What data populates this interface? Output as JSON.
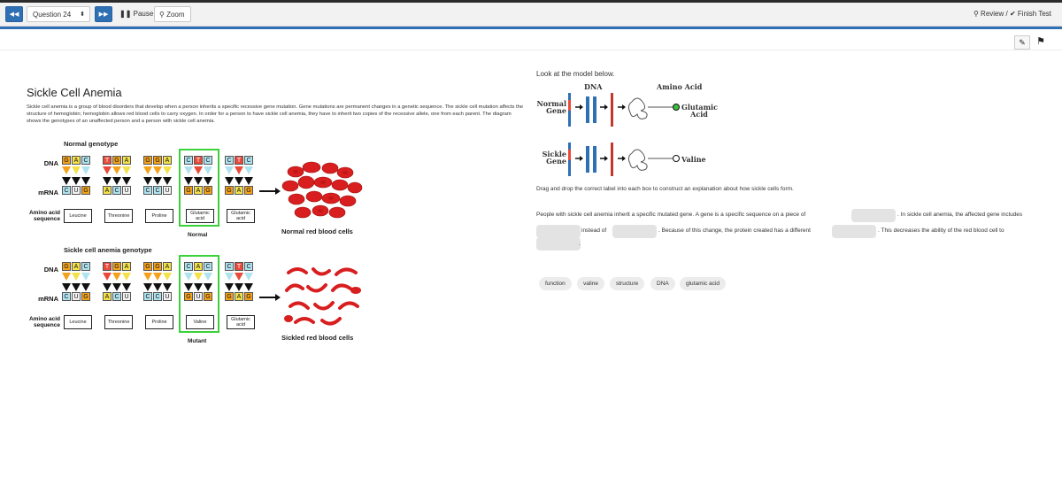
{
  "toolbar": {
    "prev_icon": "rewind-icon",
    "question_select": "Question 24",
    "next_icon": "fast-forward-icon",
    "pause_label": "Pause",
    "zoom_label": "Zoom",
    "review_label": "Review /",
    "finish_label": "Finish Test"
  },
  "icons": {
    "note": "note-edit-icon",
    "flag": "flag-icon"
  },
  "passage": {
    "title": "Sickle Cell Anemia",
    "intro": "Sickle cell anemia is a group of blood disorders that develop when a person inherits a specific recessive gene mutation. Gene mutations are permanent changes in a genetic sequence. The sickle cell mutation affects the structure of hemoglobin; hemoglobin allows red blood cells to carry oxygen. In order for a person to have sickle cell anemia, they have to inherit two copies of the recessive allele, one from each parent. The diagram shows the genotypes of an unaffected person and a person with sickle cell anemia.",
    "diagram": {
      "normal": {
        "heading": "Normal genotype",
        "dna_label": "DNA",
        "mrna_label": "mRNA",
        "aa_label": "Amino acid sequence",
        "dna": [
          "GAC",
          "TGA",
          "GGA",
          "CTC",
          "CTC"
        ],
        "mrna": [
          "CUG",
          "ACU",
          "CCU",
          "GAG",
          "GAG"
        ],
        "amino_acids": [
          "Leucine",
          "Threonine",
          "Proline",
          "Glutamic acid",
          "Glutamic acid"
        ],
        "highlight_caption": "Normal",
        "cells_caption": "Normal red blood cells"
      },
      "sickle": {
        "heading": "Sickle cell anemia genotype",
        "dna_label": "DNA",
        "mrna_label": "mRNA",
        "aa_label": "Amino acid sequence",
        "dna": [
          "GAC",
          "TGA",
          "GGA",
          "CAC",
          "CTC"
        ],
        "mrna": [
          "CUG",
          "ACU",
          "CCU",
          "GUG",
          "GAG"
        ],
        "amino_acids": [
          "Leucine",
          "Threonine",
          "Proline",
          "Valine",
          "Glutamic acid"
        ],
        "highlight_caption": "Mutant",
        "cells_caption": "Sickled red blood cells"
      }
    }
  },
  "question": {
    "prompt": "Look at the model below.",
    "model": {
      "dna_header": "DNA",
      "amino_header": "Amino Acid",
      "normal_label": "Normal Gene",
      "normal_result": "Glutamic Acid",
      "sickle_label": "Sickle Gene",
      "sickle_result": "Valine"
    },
    "instructions": "Drag and drop the correct label into each box to construct an explanation about how sickle cells form.",
    "sentence_parts": [
      "People with sickle cell anemia inherit a specific mutated gene. A gene is a specific sequence on a piece of",
      ". In sickle cell anemia, the affected gene includes",
      "instead of",
      ". Because of this change, the protein created has a different",
      ". This decreases the ability of the red blood cell to",
      "."
    ],
    "choices": [
      "function",
      "valine",
      "structure",
      "DNA",
      "glutamic acid"
    ]
  },
  "colors": {
    "accent_blue": "#2f6fb3",
    "highlight_green": "#3bd13b",
    "blood_red": "#d81e1e"
  }
}
